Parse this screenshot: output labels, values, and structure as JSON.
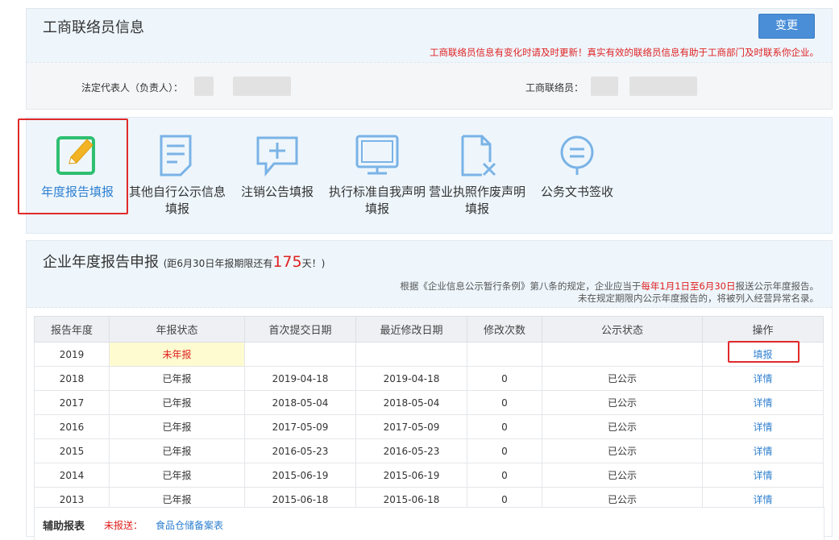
{
  "liaison": {
    "title": "工商联络员信息",
    "change_label": "变更",
    "notice": "工商联络员信息有变化时请及时更新！真实有效的联络员信息有助于工商部门及时联系你企业。",
    "legal_rep_label": "法定代表人（负责人）：",
    "liaison_label": "工商联络员："
  },
  "functions": [
    {
      "label": "年度报告填报",
      "icon": "edit-icon"
    },
    {
      "label": "其他自行公示信息填报",
      "icon": "document-icon"
    },
    {
      "label": "注销公告填报",
      "icon": "message-plus-icon"
    },
    {
      "label": "执行标准自我声明填报",
      "icon": "monitor-icon"
    },
    {
      "label": "营业执照作废声明填报",
      "icon": "file-cancel-icon"
    },
    {
      "label": "公务文书签收",
      "icon": "sign-icon"
    }
  ],
  "report": {
    "title": "企业年度报告申报",
    "deadline_pre": "(距6月30日年报期限还有",
    "days": "175",
    "deadline_post": "天！)",
    "desc1_a": "根据《企业信息公示暂行条例》第八条的规定，企业应当于",
    "desc1_red": "每年1月1日至6月30日",
    "desc1_b": "报送公示年度报告。",
    "desc2": "未在规定期限内公示年度报告的，将被列入经营异常名录。",
    "columns": [
      "报告年度",
      "年报状态",
      "首次提交日期",
      "最近修改日期",
      "修改次数",
      "公示状态",
      "操作"
    ],
    "rows": [
      {
        "year": "2019",
        "status": "未年报",
        "first": "",
        "last": "",
        "count": "",
        "pub": "",
        "op": "填报"
      },
      {
        "year": "2018",
        "status": "已年报",
        "first": "2019-04-18",
        "last": "2019-04-18",
        "count": "0",
        "pub": "已公示",
        "op": "详情"
      },
      {
        "year": "2017",
        "status": "已年报",
        "first": "2018-05-04",
        "last": "2018-05-04",
        "count": "0",
        "pub": "已公示",
        "op": "详情"
      },
      {
        "year": "2016",
        "status": "已年报",
        "first": "2017-05-09",
        "last": "2017-05-09",
        "count": "0",
        "pub": "已公示",
        "op": "详情"
      },
      {
        "year": "2015",
        "status": "已年报",
        "first": "2016-05-23",
        "last": "2016-05-23",
        "count": "0",
        "pub": "已公示",
        "op": "详情"
      },
      {
        "year": "2014",
        "status": "已年报",
        "first": "2015-06-19",
        "last": "2015-06-19",
        "count": "0",
        "pub": "已公示",
        "op": "详情"
      },
      {
        "year": "2013",
        "status": "已年报",
        "first": "2015-06-18",
        "last": "2015-06-18",
        "count": "0",
        "pub": "已公示",
        "op": "详情"
      }
    ]
  },
  "aux": {
    "title": "辅助报表",
    "state": "未报送：",
    "link": "食品仓储备案表"
  },
  "colors": {
    "accent": "#2f7fd0",
    "active_icon": "#2fbf71",
    "icon": "#7ab3e6",
    "alert": "#e02020"
  }
}
